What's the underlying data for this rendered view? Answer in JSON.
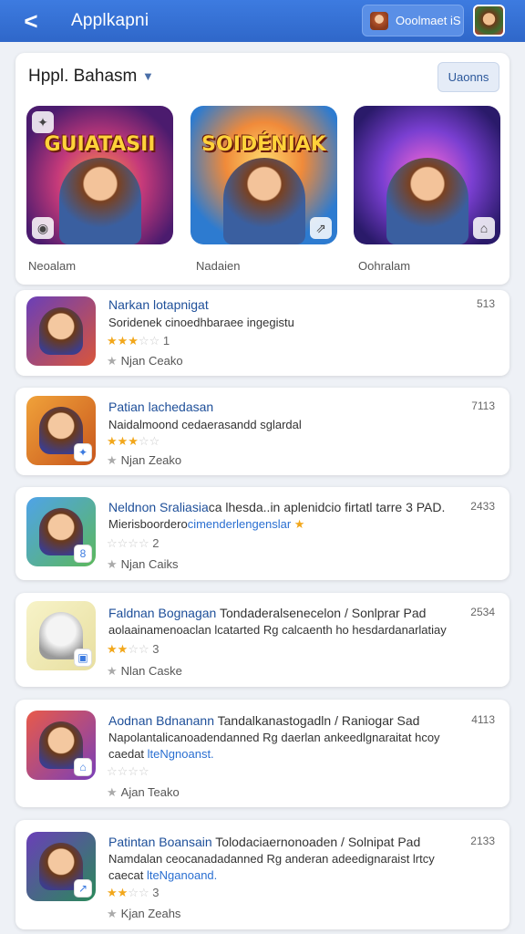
{
  "header": {
    "back_glyph": "<",
    "title": "Applkapni",
    "account_label": "Ooolmaet iS",
    "colors": {
      "bar": "#2f67c9",
      "accent": "#1e4f99"
    }
  },
  "featured": {
    "title": "Hppl. Bahasm",
    "caret": "▼",
    "view_button": "Uaonns",
    "tiles": [
      {
        "art_title": "GUIATASII",
        "label": "Neoalam"
      },
      {
        "art_title": "SOIDÉNIAK",
        "label": "Nadaien"
      },
      {
        "art_title": "",
        "label": "Oohralam"
      }
    ]
  },
  "list": [
    {
      "title": "Narkan lotapnigat",
      "title_rest": "",
      "desc": "Soridenek cinoedhbaraee ingegistu",
      "desc_link": "",
      "rating_stars": 3,
      "rating_text": "1",
      "developer": "Njan Ceako",
      "count": "513"
    },
    {
      "title": "Patian lachedasan",
      "title_rest": "",
      "desc": "Naidalmoond cedaerasandd sglardal",
      "desc_link": "",
      "rating_stars": 3,
      "rating_text": "",
      "developer": "Njan Zeako",
      "count": "7113"
    },
    {
      "title": "Neldnon Sraliasia",
      "title_rest": "ca lhesda..in aplenidcio firtatl tarre 3 PAD.",
      "desc": "Mierisboordero",
      "desc_link": "cimenderlengenslar",
      "rating_stars": 0,
      "rating_text": "2",
      "developer": "Njan Caiks",
      "count": "2433"
    },
    {
      "title": "Faldnan Bognagan",
      "title_rest": "Tondaderalsenecelon / Sonlprar Pad",
      "desc": "aolaainamenoaclan lcatarted Rg calcaenth ho hesdardanarlatiay",
      "desc_link": "",
      "rating_stars": 2,
      "rating_text": "3",
      "developer": "Nlan Caske",
      "count": "2534"
    },
    {
      "title": "Aodnan Bdnanann",
      "title_rest": "Tandalkanastogadln / Raniogar Sad",
      "desc": "Napolantalicanoadendanned Rg daerlan ankeedlgnaraitat hcoy",
      "desc_link": "lteNgnoanst.",
      "desc_pre": "caedat",
      "rating_stars": 0,
      "rating_text": "",
      "developer": "Ajan Teako",
      "count": "4113"
    },
    {
      "title": "Patintan Boansain",
      "title_rest": "Tolodaciaernonoaden / Solnipat Pad",
      "desc": "Namdalan ceocanadadanned Rg anderan adeedignaraist lrtcy",
      "desc_link": "lteNganoand.",
      "desc_pre": "caecat",
      "rating_stars": 2,
      "rating_text": "3",
      "developer": "Kjan Zeahs",
      "count": "2133"
    }
  ]
}
